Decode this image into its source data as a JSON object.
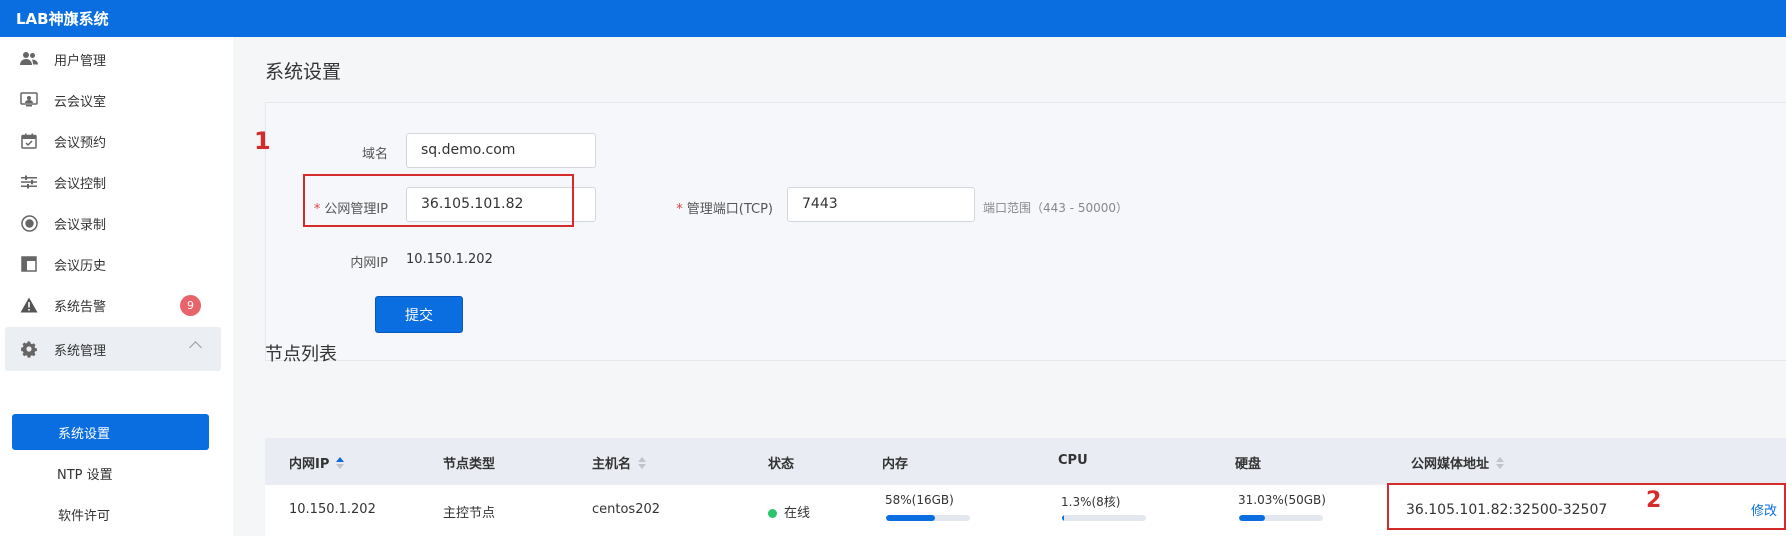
{
  "app": {
    "title": "LAB神旗系统"
  },
  "sidebar": {
    "items": [
      {
        "label": "用户管理",
        "icon": "users-icon"
      },
      {
        "label": "云会议室",
        "icon": "meeting-room-icon"
      },
      {
        "label": "会议预约",
        "icon": "calendar-check-icon"
      },
      {
        "label": "会议控制",
        "icon": "sliders-icon"
      },
      {
        "label": "会议录制",
        "icon": "record-icon"
      },
      {
        "label": "会议历史",
        "icon": "history-icon"
      },
      {
        "label": "系统告警",
        "icon": "alert-icon",
        "badge": "9"
      },
      {
        "label": "系统管理",
        "icon": "gear-icon",
        "expanded": true
      }
    ],
    "subitems": [
      {
        "label": "系统设置",
        "active": true
      },
      {
        "label": "NTP 设置"
      },
      {
        "label": "软件许可"
      }
    ]
  },
  "page": {
    "title": "系统设置"
  },
  "form": {
    "domain_label": "域名",
    "domain_value": "sq.demo.com",
    "public_ip_label": "公网管理IP",
    "public_ip_value": "36.105.101.82",
    "port_label": "管理端口(TCP)",
    "port_value": "7443",
    "port_hint": "端口范围（443 - 50000）",
    "internal_ip_label": "内网IP",
    "internal_ip_value": "10.150.1.202",
    "submit_label": "提交"
  },
  "annotations": {
    "first": "1",
    "second": "2"
  },
  "nodes": {
    "title": "节点列表",
    "columns": [
      "内网IP",
      "节点类型",
      "主机名",
      "状态",
      "内存",
      "CPU",
      "硬盘",
      "公网媒体地址"
    ],
    "rows": [
      {
        "internal_ip": "10.150.1.202",
        "node_type": "主控节点",
        "hostname": "centos202",
        "status": "在线",
        "memory": "58%(16GB)",
        "memory_pct": 58,
        "cpu": "1.3%(8核)",
        "cpu_pct": 1.3,
        "disk": "31.03%(50GB)",
        "disk_pct": 31.03,
        "media_address": "36.105.101.82:32500-32507",
        "action": "修改"
      }
    ]
  },
  "colors": {
    "primary": "#0a6ee0",
    "danger": "#d52b2b",
    "online": "#29c46b",
    "badge": "#e8646a"
  }
}
